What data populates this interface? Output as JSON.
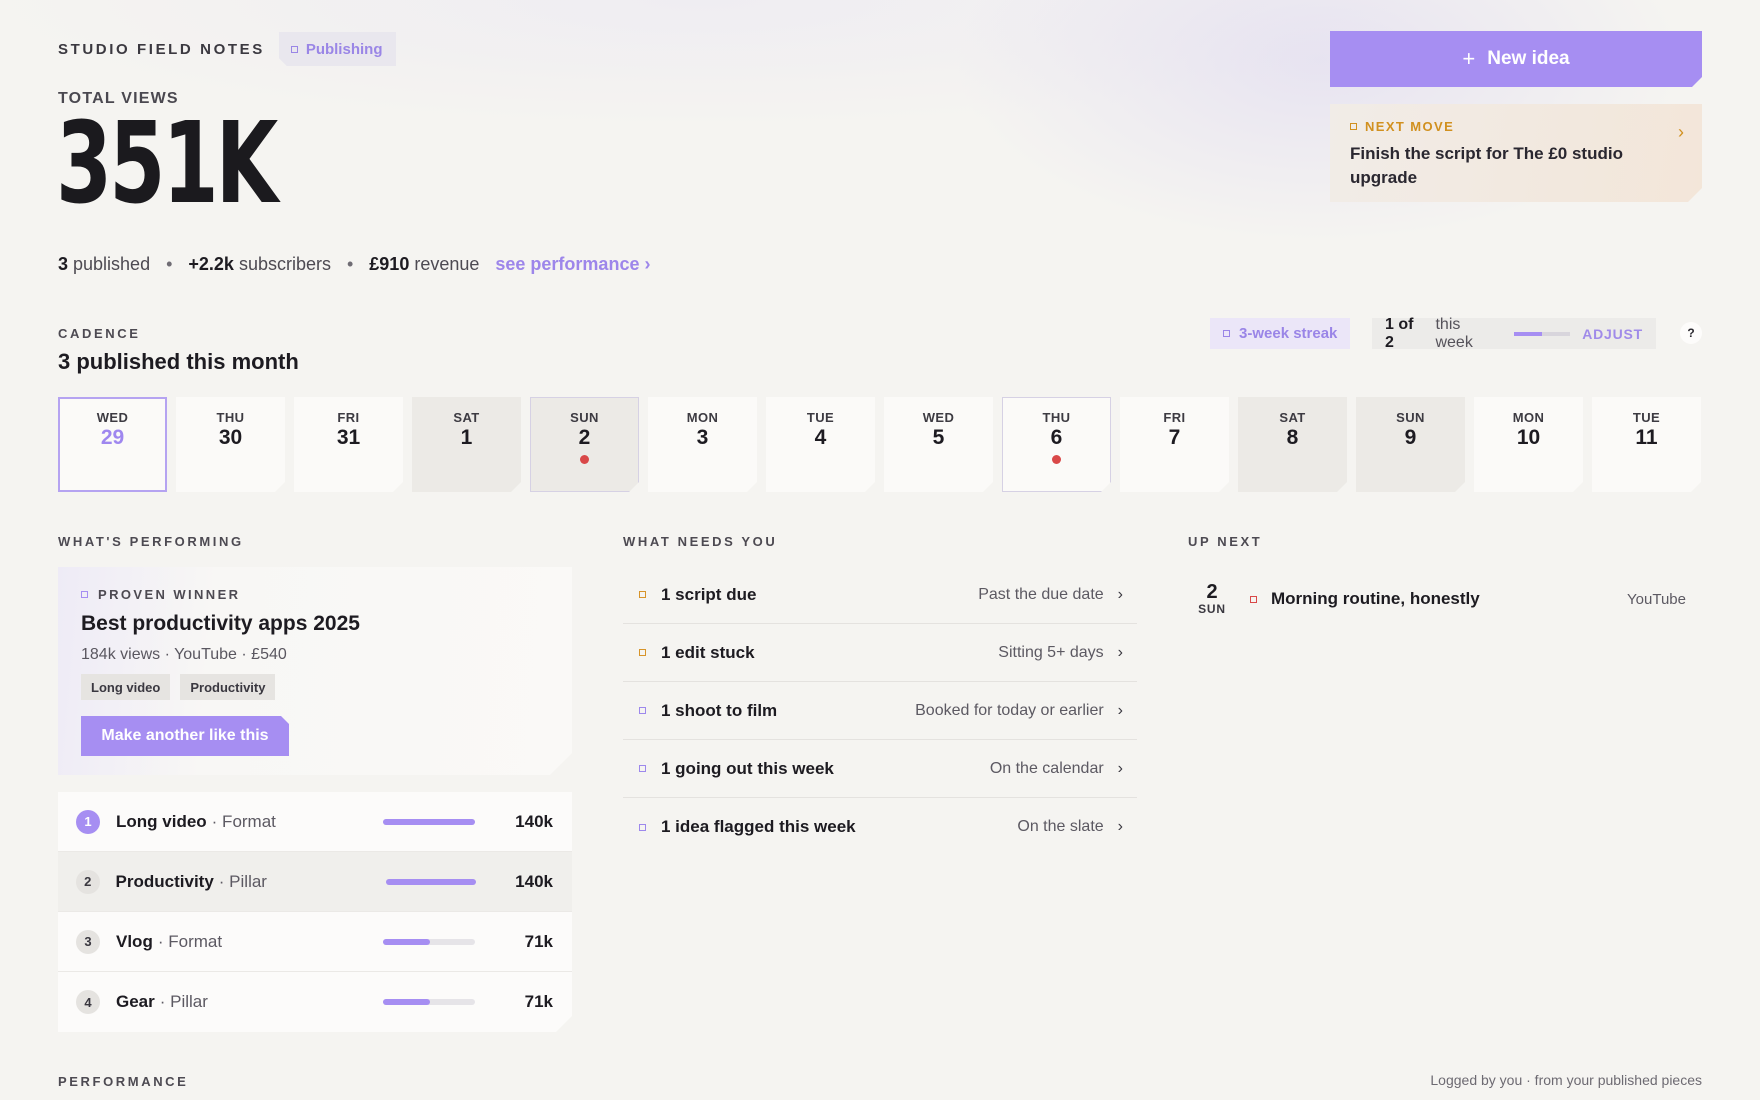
{
  "header": {
    "brand": "STUDIO FIELD NOTES",
    "status_tag": "Publishing",
    "total_label": "TOTAL VIEWS",
    "total_value": "351K",
    "stats": {
      "published_value": "3",
      "published_label": "published",
      "subs_value": "+2.2k",
      "subs_label": "subscribers",
      "revenue_value": "£910",
      "revenue_label": "revenue",
      "link": "see performance ›"
    },
    "separator": "•"
  },
  "actions": {
    "new_idea_icon": "plus-icon",
    "new_idea_plus": "+",
    "new_idea_label": "New idea",
    "next_move_eyebrow": "NEXT MOVE",
    "next_move_text": "Finish the script for The £0 studio upgrade",
    "next_move_chevron": "›"
  },
  "cadence": {
    "label": "CADENCE",
    "title": "3 published this month",
    "streak": "3-week streak",
    "goal_done": "1 of 2",
    "goal_suffix": "this week",
    "goal_progress": 0.5,
    "adjust": "ADJUST",
    "help": "?",
    "days": [
      {
        "dow": "WED",
        "num": "29",
        "state": "selected"
      },
      {
        "dow": "THU",
        "num": "30",
        "state": "normal"
      },
      {
        "dow": "FRI",
        "num": "31",
        "state": "normal"
      },
      {
        "dow": "SAT",
        "num": "1",
        "state": "weekend"
      },
      {
        "dow": "SUN",
        "num": "2",
        "state": "weekend-outlined",
        "published": true
      },
      {
        "dow": "MON",
        "num": "3",
        "state": "normal"
      },
      {
        "dow": "TUE",
        "num": "4",
        "state": "normal"
      },
      {
        "dow": "WED",
        "num": "5",
        "state": "normal"
      },
      {
        "dow": "THU",
        "num": "6",
        "state": "outlined",
        "published": true
      },
      {
        "dow": "FRI",
        "num": "7",
        "state": "normal"
      },
      {
        "dow": "SAT",
        "num": "8",
        "state": "weekend"
      },
      {
        "dow": "SUN",
        "num": "9",
        "state": "weekend"
      },
      {
        "dow": "MON",
        "num": "10",
        "state": "normal"
      },
      {
        "dow": "TUE",
        "num": "11",
        "state": "normal"
      }
    ]
  },
  "performing": {
    "label": "WHAT'S PERFORMING",
    "winner": {
      "eyebrow": "PROVEN WINNER",
      "title": "Best productivity apps 2025",
      "meta": "184k views · YouTube · £540",
      "chips": [
        "Long video",
        "Productivity"
      ],
      "cta": "Make another like this"
    },
    "ranks": [
      {
        "rank": "1",
        "name": "Long video",
        "kind": "· Format",
        "value": "140k",
        "share": 1.0
      },
      {
        "rank": "2",
        "name": "Productivity",
        "kind": "· Pillar",
        "value": "140k",
        "share": 1.0
      },
      {
        "rank": "3",
        "name": "Vlog",
        "kind": "· Format",
        "value": "71k",
        "share": 0.51
      },
      {
        "rank": "4",
        "name": "Gear",
        "kind": "· Pillar",
        "value": "71k",
        "share": 0.51
      }
    ]
  },
  "needs": {
    "label": "WHAT NEEDS YOU",
    "chevron": "›",
    "items": [
      {
        "label": "1 script due",
        "hint": "Past the due date",
        "tone": "warn"
      },
      {
        "label": "1 edit stuck",
        "hint": "Sitting 5+ days",
        "tone": "warn"
      },
      {
        "label": "1 shoot to film",
        "hint": "Booked for today or earlier",
        "tone": "info"
      },
      {
        "label": "1 going out this week",
        "hint": "On the calendar",
        "tone": "info"
      },
      {
        "label": "1 idea flagged this week",
        "hint": "On the slate",
        "tone": "info"
      }
    ]
  },
  "upnext": {
    "label": "UP NEXT",
    "item": {
      "day_num": "2",
      "day_dow": "SUN",
      "title": "Morning routine, honestly",
      "platform": "YouTube"
    }
  },
  "footer": {
    "label": "PERFORMANCE",
    "note": "Logged by you · from your published pieces"
  },
  "colors": {
    "accent": "#a68ef2",
    "warn": "#d7942a",
    "danger": "#d94848",
    "background": "#f5f4f1"
  }
}
